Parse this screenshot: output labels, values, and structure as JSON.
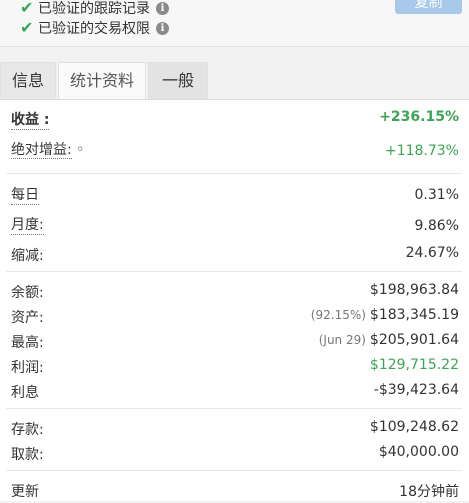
{
  "verification": {
    "line1": "已验证的跟踪记录",
    "line2": "已验证的交易权限",
    "copy_button": "复制"
  },
  "tabs": [
    "信息",
    "统计资料",
    "一般"
  ],
  "stats": {
    "gain": {
      "label": "收益 :",
      "value": "+236.15%"
    },
    "abs_gain": {
      "label": "绝对增益:",
      "marker": "◦",
      "value": "+118.73%"
    },
    "daily": {
      "label": "每日",
      "value": "0.31%"
    },
    "monthly": {
      "label": "月度:",
      "value": "9.86%"
    },
    "drawdown": {
      "label": "缩减:",
      "value": "24.67%"
    },
    "balance": {
      "label": "余额:",
      "value": "$198,963.84"
    },
    "equity": {
      "label": "资产:",
      "note": "(92.15%)",
      "value": "$183,345.19"
    },
    "highest": {
      "label": "最高:",
      "note": "(Jun 29)",
      "value": "$205,901.64"
    },
    "profit": {
      "label": "利润:",
      "value": "$129,715.22"
    },
    "interest": {
      "label": "利息",
      "value": "-$39,423.64"
    },
    "deposits": {
      "label": "存款:",
      "value": "$109,248.62"
    },
    "withdrawals": {
      "label": "取款:",
      "value": "$40,000.00"
    },
    "updated": {
      "label": "更新",
      "value": "18分钟前"
    }
  },
  "colors": {
    "green": "#3aa655",
    "button": "#a9c9ea"
  }
}
